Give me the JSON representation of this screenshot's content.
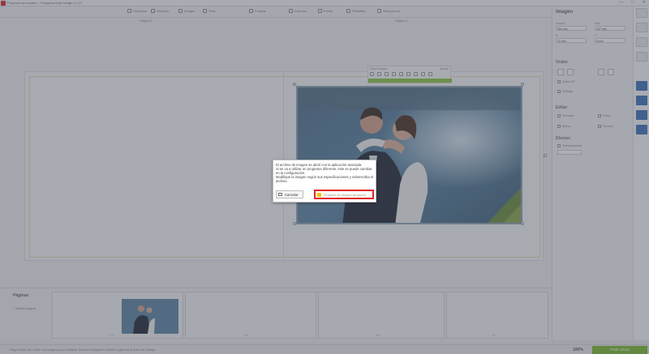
{
  "window": {
    "title": "Proyecto sin nombre - Programa Saal Design 4.1.27",
    "controls": [
      "—",
      "□",
      "✕"
    ]
  },
  "toolbar": {
    "items": [
      {
        "label": "Deshacer",
        "icon": "undo-icon"
      },
      {
        "label": "Rehacer",
        "icon": "redo-icon"
      },
      {
        "label": "Imagen",
        "icon": "image-icon"
      },
      {
        "label": "Texto",
        "icon": "text-icon"
      },
      {
        "label": "Formas",
        "icon": "shape-icon"
      },
      {
        "label": "Adornos",
        "icon": "decor-icon"
      },
      {
        "label": "Fondo",
        "icon": "background-icon"
      },
      {
        "label": "Plantillas",
        "icon": "template-icon"
      },
      {
        "label": "Vista previa",
        "icon": "preview-icon"
      }
    ]
  },
  "subheader": {
    "left_page": "Página 0",
    "right_page": "Página 1"
  },
  "photo_toolbar": {
    "title": "Editar imagen",
    "mode": "Ajustar"
  },
  "right_panel": {
    "title": "Imagen",
    "labels": {
      "size": "Tamaño",
      "position": "Posición",
      "width": "Ancho",
      "height": "Alto",
      "x": "X",
      "y": "Y"
    },
    "values": {
      "width": "254 mm",
      "height": "157 mm",
      "x": "12 mm",
      "y": "8 mm"
    },
    "sections": {
      "arrange": "Orden",
      "edit": "Editar",
      "effects": "Efectos"
    },
    "options": [
      "Rotar 90°",
      "Reflejar",
      "Recortar",
      "Filtros",
      "Marco",
      "Sombra",
      "Transparencia"
    ]
  },
  "pages": {
    "title": "Páginas",
    "add_label": "+ Añadir página",
    "thumb_numbers": [
      "0-1",
      "2-3",
      "4-5",
      "6-7"
    ]
  },
  "status": {
    "text": "Haga doble clic sobre una página para editarla. Arrastre imágenes desde la galería al área de trabajo.",
    "zoom": "100%",
    "order_button": "Pedir ahora"
  },
  "dialog": {
    "message_lines": [
      "El archivo de imagen se abrió con la aplicación asociada.",
      "Si se va a utilizar un programa diferente, este se puede cambiar",
      "en la configuración.",
      "Modifique la imagen según sus especificaciones y sobrescriba el",
      "archivo."
    ],
    "cancel_label": "Cancelar",
    "finish_label": "Finalizar de imagen temporal"
  },
  "colors": {
    "accent_green": "#8cc63f",
    "highlight_red": "#e2252b",
    "overlay": "#464e5a",
    "brand_red": "#d3232a"
  }
}
